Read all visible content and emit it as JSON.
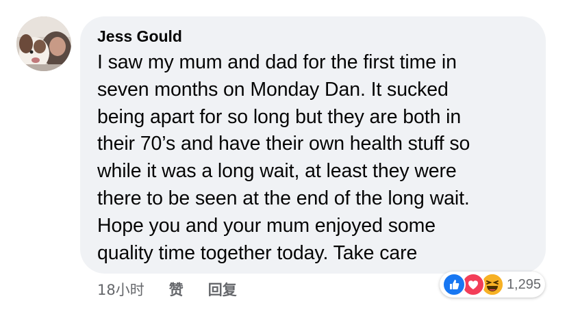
{
  "comment": {
    "author": "Jess Gould",
    "text": "I saw my mum and dad for the first time in\nseven months on Monday Dan. It sucked\nbeing apart for so long but they are both in\ntheir 70’s and have their own health stuff so\nwhile it was a long wait, at least they were\nthere to be seen at the end of the long wait.\nHope you and your mum enjoyed some\nquality time together today. Take care"
  },
  "actions": {
    "time": "18小时",
    "like_label": "赞",
    "reply_label": "回复"
  },
  "reactions": {
    "icons": [
      "like-icon",
      "love-icon",
      "haha-icon"
    ],
    "count": "1,295"
  },
  "colors": {
    "bubble": "#f0f2f5",
    "text": "#050505",
    "secondary": "#65676b",
    "like": "#1877f2",
    "love": "#f33e58",
    "haha": "#f7b125"
  }
}
